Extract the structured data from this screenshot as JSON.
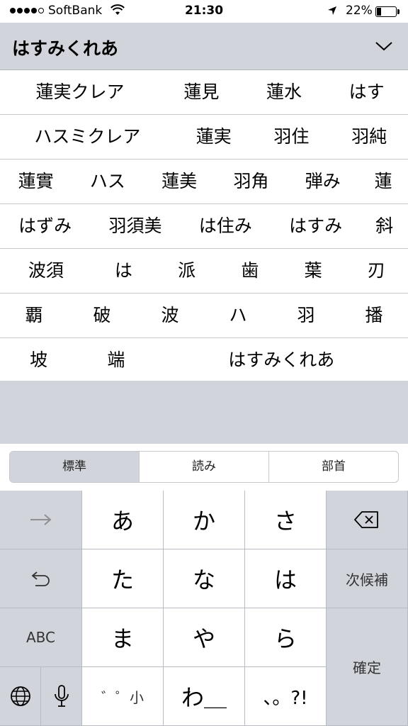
{
  "status_bar": {
    "carrier": "SoftBank",
    "time": "21:30",
    "battery_percent": "22%",
    "battery_level": 0.22,
    "signal_bars_filled": 4
  },
  "composition": {
    "reading": "はすみくれあ",
    "collapse_icon": "chevron-down-icon"
  },
  "candidates": [
    [
      "蓮実クレア",
      "蓮見",
      "蓮水",
      "はす"
    ],
    [
      "ハスミクレア",
      "蓮実",
      "羽住",
      "羽純"
    ],
    [
      "蓮實",
      "ハス",
      "蓮美",
      "羽角",
      "弾み",
      "蓮"
    ],
    [
      "はずみ",
      "羽須美",
      "は住み",
      "はすみ",
      "斜"
    ],
    [
      "波須",
      "は",
      "派",
      "歯",
      "葉",
      "刃"
    ],
    [
      "覇",
      "破",
      "波",
      "ハ",
      "羽",
      "播"
    ],
    [
      "坡",
      "端",
      "はすみくれあ"
    ]
  ],
  "lookup_tabs": [
    "標準",
    "読み",
    "部首"
  ],
  "active_tab": "標準",
  "keyboard": {
    "next_candidate": "次候補",
    "abc": "ABC",
    "confirm": "確定",
    "kana": {
      "a": "あ",
      "ka": "か",
      "sa": "さ",
      "ta": "た",
      "na": "な",
      "ha": "は",
      "ma": "ま",
      "ya": "や",
      "ra": "ら",
      "dakuten": "゛゜小",
      "wa": "わ＿",
      "punct": "、。?!"
    },
    "icons": {
      "arrow": "arrow-right-icon",
      "undo": "undo-icon",
      "globe": "globe-icon",
      "mic": "microphone-icon",
      "delete": "delete-icon"
    }
  },
  "colors": {
    "keyboard_gray": "#d1d5db",
    "key_white": "#ffffff",
    "divider": "#c8c8cc"
  }
}
